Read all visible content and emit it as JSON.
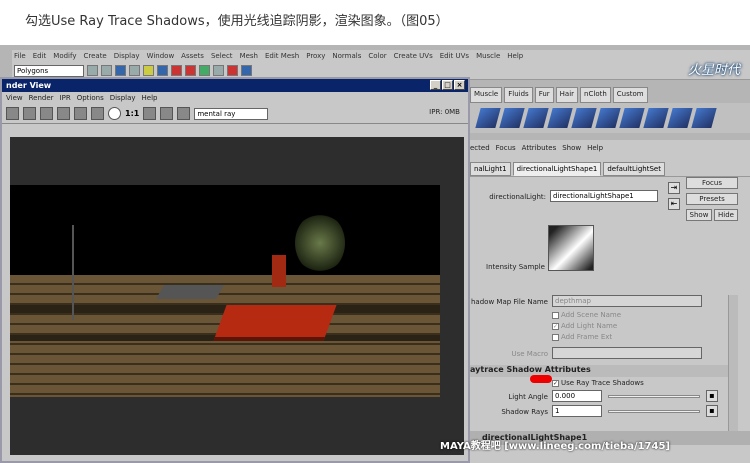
{
  "caption": "勾选Use Ray Trace Shadows，使用光线追踪阴影，渲染图象。（图05）",
  "main_menu": [
    "File",
    "Edit",
    "Modify",
    "Create",
    "Display",
    "Window",
    "Assets",
    "Select",
    "Mesh",
    "Edit Mesh",
    "Proxy",
    "Normals",
    "Color",
    "Create UVs",
    "Edit UVs",
    "Muscle",
    "Help"
  ],
  "mode_combo": "Polygons",
  "logo_text": "火星时代",
  "shelf_tabs": [
    "Muscle",
    "Fluids",
    "Fur",
    "Hair",
    "nCloth",
    "Custom"
  ],
  "render_view": {
    "title": "nder View",
    "menu": [
      "View",
      "Render",
      "IPR",
      "Options",
      "Display",
      "Help"
    ],
    "ratio": "1:1",
    "renderer": "mental ray",
    "ipr_status": "IPR: 0MB"
  },
  "attr_editor": {
    "menu": [
      "ected",
      "Focus",
      "Attributes",
      "Show",
      "Help"
    ],
    "tabs": [
      "nalLight1",
      "directionalLightShape1",
      "defaultLightSet"
    ],
    "node_label": "directionalLight:",
    "node_value": "directionalLightShape1",
    "buttons": {
      "focus": "Focus",
      "presets": "Presets",
      "show": "Show",
      "hide": "Hide"
    },
    "intensity_label": "Intensity Sample",
    "shadow_map_label": "hadow Map File Name",
    "shadow_map_value": "depthmap",
    "add_scene_name": "Add Scene Name",
    "add_light_name": "Add Light Name",
    "add_frame_ext": "Add Frame Ext",
    "use_macro": "Use Macro",
    "section_title": "aytrace Shadow Attributes",
    "use_raytrace_label": "Use Ray Trace Shadows",
    "light_angle_label": "Light Angle",
    "light_angle_value": "0.000",
    "shadow_rays_label": "Shadow Rays",
    "shadow_rays_value": "1",
    "footer_title": "directionalLightShape1"
  },
  "watermark": "MAYA教程吧  [www.lineeg.com/tieba/1745]"
}
